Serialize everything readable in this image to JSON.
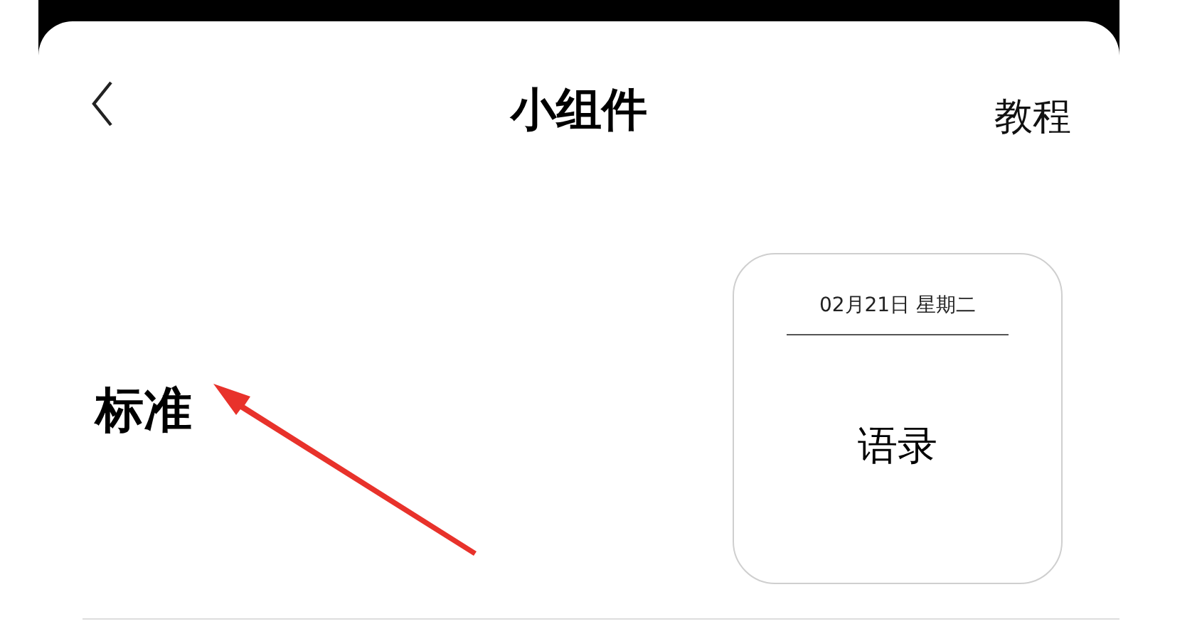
{
  "header": {
    "title": "小组件",
    "action": "教程"
  },
  "widget_style": {
    "label": "标准"
  },
  "widget_preview": {
    "date": "02月21日 星期二",
    "text": "语录"
  }
}
